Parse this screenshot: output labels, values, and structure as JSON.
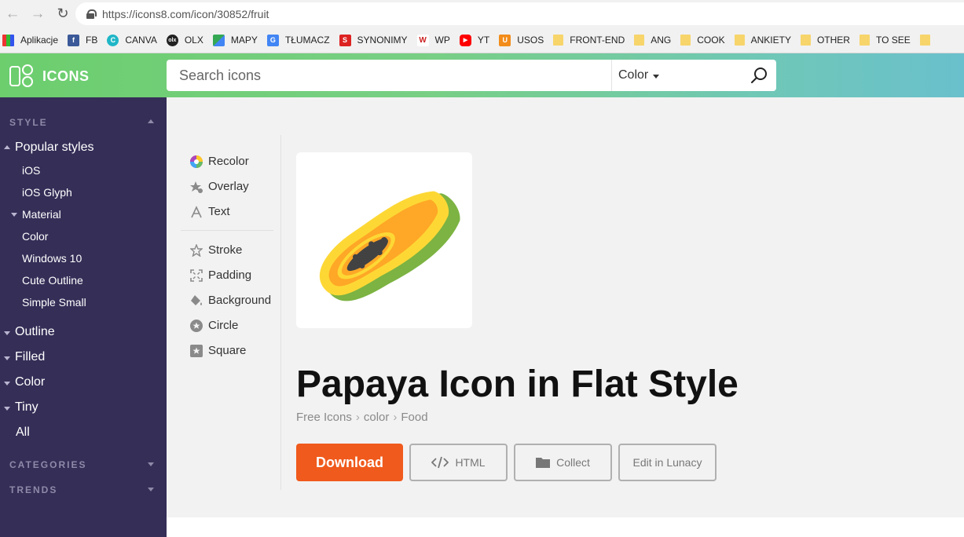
{
  "browser": {
    "url": "https://icons8.com/icon/30852/fruit",
    "bookmarks": [
      {
        "label": "Aplikacje",
        "icon": "apps-grid-icon",
        "color": "#e33"
      },
      {
        "label": "FB",
        "icon": "facebook-icon",
        "color": "#3b5998"
      },
      {
        "label": "CANVA",
        "icon": "canva-icon",
        "color": "#1fb6c7"
      },
      {
        "label": "OLX",
        "icon": "olx-icon",
        "color": "#222"
      },
      {
        "label": "MAPY",
        "icon": "maps-icon",
        "color": "#34a853"
      },
      {
        "label": "TŁUMACZ",
        "icon": "translate-icon",
        "color": "#4285f4"
      },
      {
        "label": "SYNONIMY",
        "icon": "synonimy-icon",
        "color": "#d22"
      },
      {
        "label": "WP",
        "icon": "wp-icon",
        "color": "#c22"
      },
      {
        "label": "YT",
        "icon": "youtube-icon",
        "color": "#f00"
      },
      {
        "label": "USOS",
        "icon": "usos-icon",
        "color": "#f28c1a"
      },
      {
        "label": "FRONT-END",
        "icon": "folder-icon",
        "color": "#f7d56b"
      },
      {
        "label": "ANG",
        "icon": "folder-icon",
        "color": "#f7d56b"
      },
      {
        "label": "COOK",
        "icon": "folder-icon",
        "color": "#f7d56b"
      },
      {
        "label": "ANKIETY",
        "icon": "folder-icon",
        "color": "#f7d56b"
      },
      {
        "label": "OTHER",
        "icon": "folder-icon",
        "color": "#f7d56b"
      },
      {
        "label": "TO SEE",
        "icon": "folder-icon",
        "color": "#f7d56b"
      }
    ]
  },
  "header": {
    "logo_text": "ICONS",
    "search_placeholder": "Search icons",
    "filter_label": "Color"
  },
  "sidebar": {
    "style_title": "STYLE",
    "popular_label": "Popular styles",
    "popular_items": [
      "iOS",
      "iOS Glyph"
    ],
    "material_label": "Material",
    "material_items": [
      "Color",
      "Windows 10",
      "Cute Outline",
      "Simple Small"
    ],
    "other_styles": [
      "Outline",
      "Filled",
      "Color",
      "Tiny"
    ],
    "all_label": "All",
    "categories_title": "CATEGORIES",
    "trends_title": "TRENDS"
  },
  "tools": {
    "recolor": "Recolor",
    "overlay": "Overlay",
    "text": "Text",
    "stroke": "Stroke",
    "padding": "Padding",
    "background": "Background",
    "circle": "Circle",
    "square": "Square"
  },
  "icon_page": {
    "title": "Papaya Icon in Flat Style",
    "breadcrumbs": [
      "Free Icons",
      "color",
      "Food"
    ],
    "buttons": {
      "download": "Download",
      "html": "HTML",
      "collect": "Collect",
      "lunacy": "Edit in Lunacy"
    }
  },
  "colors": {
    "accent_download": "#f05a1c",
    "sidebar_bg": "#352e57",
    "header_green": "#6cce6d",
    "header_teal": "#6ac0cc"
  }
}
